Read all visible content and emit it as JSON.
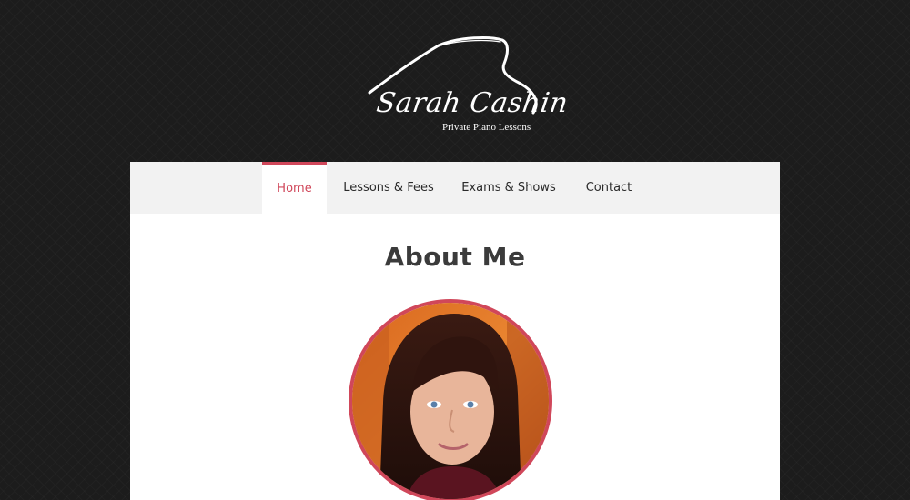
{
  "site": {
    "name": "Sarah Cashin",
    "tagline": "Private Piano Lessons"
  },
  "nav": {
    "items": [
      {
        "label": "Home",
        "active": true
      },
      {
        "label": "Lessons & Fees",
        "active": false
      },
      {
        "label": "Exams & Shows",
        "active": false
      },
      {
        "label": "Contact",
        "active": false
      }
    ]
  },
  "main": {
    "title": "About Me"
  },
  "colors": {
    "accent": "#d0475a",
    "background": "#1c1c1c",
    "nav_background": "#f2f2f2",
    "panel": "#ffffff",
    "title_text": "#3b3b3b"
  },
  "icons": {
    "logo": "grand-piano-outline-icon",
    "avatar": "profile-photo"
  }
}
